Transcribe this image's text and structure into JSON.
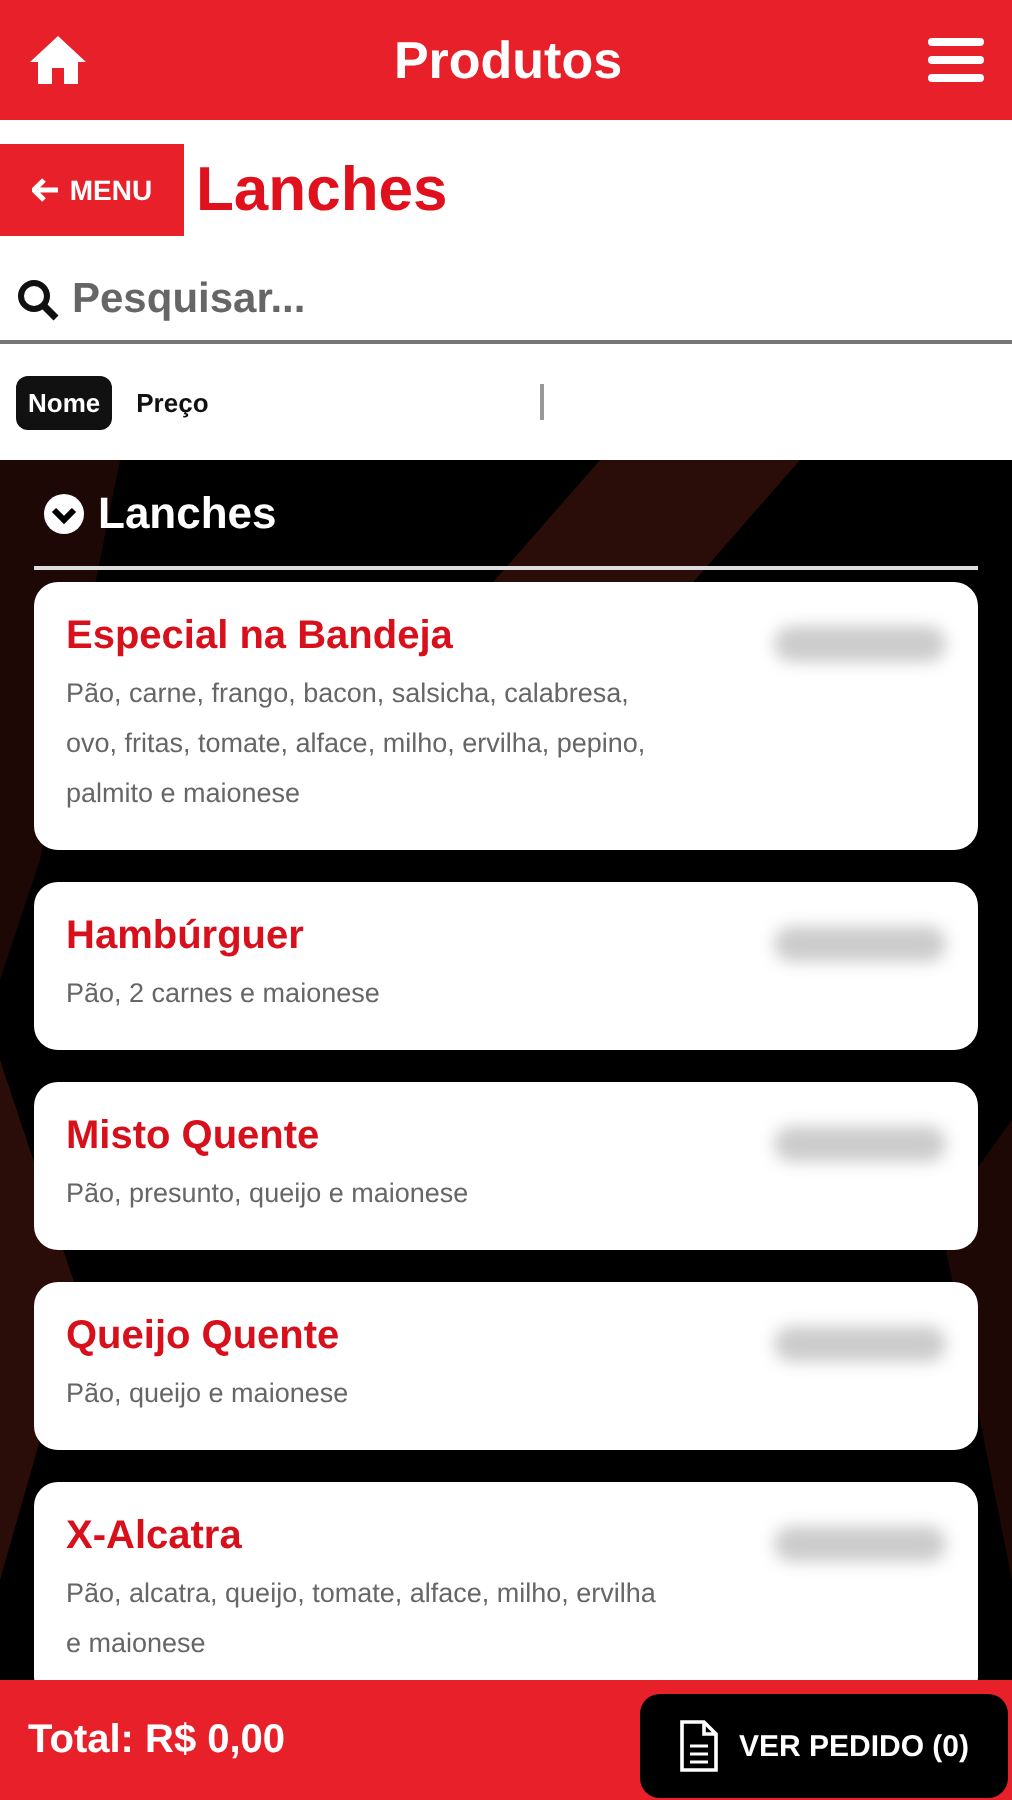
{
  "header": {
    "title": "Produtos"
  },
  "back_button": {
    "label": "MENU"
  },
  "page_title": "Lanches",
  "search": {
    "placeholder": "Pesquisar..."
  },
  "sort_options": [
    {
      "label": "Nome",
      "selected": true
    },
    {
      "label": "Preço",
      "selected": false
    }
  ],
  "category": {
    "name": "Lanches",
    "expanded": true
  },
  "products": [
    {
      "name": "Especial na Bandeja",
      "description": "Pão, carne, frango, bacon, salsicha, calabresa, ovo, fritas, tomate, alface, milho, ervilha, pepino, palmito e maionese"
    },
    {
      "name": "Hambúrguer",
      "description": "Pão, 2 carnes e maionese"
    },
    {
      "name": "Misto Quente",
      "description": "Pão, presunto, queijo e maionese"
    },
    {
      "name": "Queijo Quente",
      "description": "Pão, queijo e maionese"
    },
    {
      "name": "X-Alcatra",
      "description": "Pão, alcatra, queijo, tomate, alface, milho, ervilha e maionese"
    }
  ],
  "footer": {
    "total": "Total: R$ 0,00",
    "order_button": "VER PEDIDO (0)"
  }
}
